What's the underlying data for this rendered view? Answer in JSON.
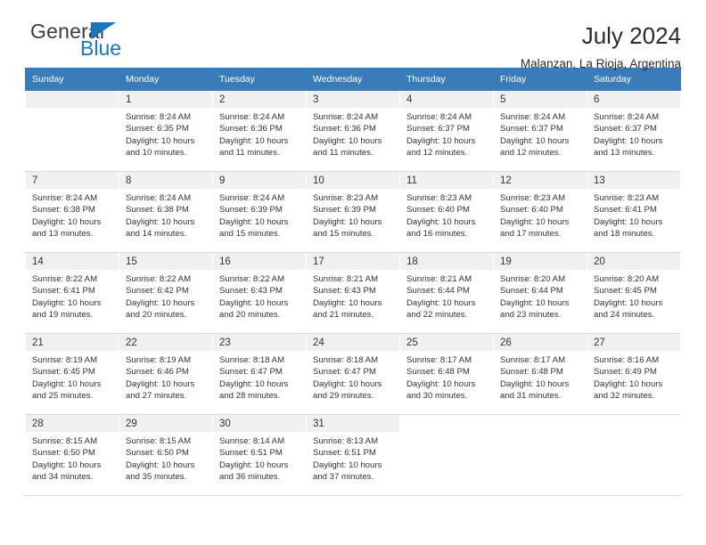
{
  "brand": {
    "name_part1": "General",
    "name_part2": "Blue",
    "triangle_color": "#1c76bc"
  },
  "header": {
    "title": "July 2024",
    "subtitle": "Malanzan, La Rioja, Argentina",
    "header_bg": "#3a7cba",
    "daynum_bg": "#f0f0f0"
  },
  "weekdays": [
    "Sunday",
    "Monday",
    "Tuesday",
    "Wednesday",
    "Thursday",
    "Friday",
    "Saturday"
  ],
  "labels": {
    "sunrise_prefix": "Sunrise: ",
    "sunset_prefix": "Sunset: ",
    "daylight_prefix": "Daylight: "
  },
  "weeks": [
    [
      {
        "day": "",
        "sunrise": "",
        "sunset": "",
        "daylight_line1": "",
        "daylight_line2": ""
      },
      {
        "day": "1",
        "sunrise": "Sunrise: 8:24 AM",
        "sunset": "Sunset: 6:35 PM",
        "daylight_line1": "Daylight: 10 hours",
        "daylight_line2": "and 10 minutes."
      },
      {
        "day": "2",
        "sunrise": "Sunrise: 8:24 AM",
        "sunset": "Sunset: 6:36 PM",
        "daylight_line1": "Daylight: 10 hours",
        "daylight_line2": "and 11 minutes."
      },
      {
        "day": "3",
        "sunrise": "Sunrise: 8:24 AM",
        "sunset": "Sunset: 6:36 PM",
        "daylight_line1": "Daylight: 10 hours",
        "daylight_line2": "and 11 minutes."
      },
      {
        "day": "4",
        "sunrise": "Sunrise: 8:24 AM",
        "sunset": "Sunset: 6:37 PM",
        "daylight_line1": "Daylight: 10 hours",
        "daylight_line2": "and 12 minutes."
      },
      {
        "day": "5",
        "sunrise": "Sunrise: 8:24 AM",
        "sunset": "Sunset: 6:37 PM",
        "daylight_line1": "Daylight: 10 hours",
        "daylight_line2": "and 12 minutes."
      },
      {
        "day": "6",
        "sunrise": "Sunrise: 8:24 AM",
        "sunset": "Sunset: 6:37 PM",
        "daylight_line1": "Daylight: 10 hours",
        "daylight_line2": "and 13 minutes."
      }
    ],
    [
      {
        "day": "7",
        "sunrise": "Sunrise: 8:24 AM",
        "sunset": "Sunset: 6:38 PM",
        "daylight_line1": "Daylight: 10 hours",
        "daylight_line2": "and 13 minutes."
      },
      {
        "day": "8",
        "sunrise": "Sunrise: 8:24 AM",
        "sunset": "Sunset: 6:38 PM",
        "daylight_line1": "Daylight: 10 hours",
        "daylight_line2": "and 14 minutes."
      },
      {
        "day": "9",
        "sunrise": "Sunrise: 8:24 AM",
        "sunset": "Sunset: 6:39 PM",
        "daylight_line1": "Daylight: 10 hours",
        "daylight_line2": "and 15 minutes."
      },
      {
        "day": "10",
        "sunrise": "Sunrise: 8:23 AM",
        "sunset": "Sunset: 6:39 PM",
        "daylight_line1": "Daylight: 10 hours",
        "daylight_line2": "and 15 minutes."
      },
      {
        "day": "11",
        "sunrise": "Sunrise: 8:23 AM",
        "sunset": "Sunset: 6:40 PM",
        "daylight_line1": "Daylight: 10 hours",
        "daylight_line2": "and 16 minutes."
      },
      {
        "day": "12",
        "sunrise": "Sunrise: 8:23 AM",
        "sunset": "Sunset: 6:40 PM",
        "daylight_line1": "Daylight: 10 hours",
        "daylight_line2": "and 17 minutes."
      },
      {
        "day": "13",
        "sunrise": "Sunrise: 8:23 AM",
        "sunset": "Sunset: 6:41 PM",
        "daylight_line1": "Daylight: 10 hours",
        "daylight_line2": "and 18 minutes."
      }
    ],
    [
      {
        "day": "14",
        "sunrise": "Sunrise: 8:22 AM",
        "sunset": "Sunset: 6:41 PM",
        "daylight_line1": "Daylight: 10 hours",
        "daylight_line2": "and 19 minutes."
      },
      {
        "day": "15",
        "sunrise": "Sunrise: 8:22 AM",
        "sunset": "Sunset: 6:42 PM",
        "daylight_line1": "Daylight: 10 hours",
        "daylight_line2": "and 20 minutes."
      },
      {
        "day": "16",
        "sunrise": "Sunrise: 8:22 AM",
        "sunset": "Sunset: 6:43 PM",
        "daylight_line1": "Daylight: 10 hours",
        "daylight_line2": "and 20 minutes."
      },
      {
        "day": "17",
        "sunrise": "Sunrise: 8:21 AM",
        "sunset": "Sunset: 6:43 PM",
        "daylight_line1": "Daylight: 10 hours",
        "daylight_line2": "and 21 minutes."
      },
      {
        "day": "18",
        "sunrise": "Sunrise: 8:21 AM",
        "sunset": "Sunset: 6:44 PM",
        "daylight_line1": "Daylight: 10 hours",
        "daylight_line2": "and 22 minutes."
      },
      {
        "day": "19",
        "sunrise": "Sunrise: 8:20 AM",
        "sunset": "Sunset: 6:44 PM",
        "daylight_line1": "Daylight: 10 hours",
        "daylight_line2": "and 23 minutes."
      },
      {
        "day": "20",
        "sunrise": "Sunrise: 8:20 AM",
        "sunset": "Sunset: 6:45 PM",
        "daylight_line1": "Daylight: 10 hours",
        "daylight_line2": "and 24 minutes."
      }
    ],
    [
      {
        "day": "21",
        "sunrise": "Sunrise: 8:19 AM",
        "sunset": "Sunset: 6:45 PM",
        "daylight_line1": "Daylight: 10 hours",
        "daylight_line2": "and 25 minutes."
      },
      {
        "day": "22",
        "sunrise": "Sunrise: 8:19 AM",
        "sunset": "Sunset: 6:46 PM",
        "daylight_line1": "Daylight: 10 hours",
        "daylight_line2": "and 27 minutes."
      },
      {
        "day": "23",
        "sunrise": "Sunrise: 8:18 AM",
        "sunset": "Sunset: 6:47 PM",
        "daylight_line1": "Daylight: 10 hours",
        "daylight_line2": "and 28 minutes."
      },
      {
        "day": "24",
        "sunrise": "Sunrise: 8:18 AM",
        "sunset": "Sunset: 6:47 PM",
        "daylight_line1": "Daylight: 10 hours",
        "daylight_line2": "and 29 minutes."
      },
      {
        "day": "25",
        "sunrise": "Sunrise: 8:17 AM",
        "sunset": "Sunset: 6:48 PM",
        "daylight_line1": "Daylight: 10 hours",
        "daylight_line2": "and 30 minutes."
      },
      {
        "day": "26",
        "sunrise": "Sunrise: 8:17 AM",
        "sunset": "Sunset: 6:48 PM",
        "daylight_line1": "Daylight: 10 hours",
        "daylight_line2": "and 31 minutes."
      },
      {
        "day": "27",
        "sunrise": "Sunrise: 8:16 AM",
        "sunset": "Sunset: 6:49 PM",
        "daylight_line1": "Daylight: 10 hours",
        "daylight_line2": "and 32 minutes."
      }
    ],
    [
      {
        "day": "28",
        "sunrise": "Sunrise: 8:15 AM",
        "sunset": "Sunset: 6:50 PM",
        "daylight_line1": "Daylight: 10 hours",
        "daylight_line2": "and 34 minutes."
      },
      {
        "day": "29",
        "sunrise": "Sunrise: 8:15 AM",
        "sunset": "Sunset: 6:50 PM",
        "daylight_line1": "Daylight: 10 hours",
        "daylight_line2": "and 35 minutes."
      },
      {
        "day": "30",
        "sunrise": "Sunrise: 8:14 AM",
        "sunset": "Sunset: 6:51 PM",
        "daylight_line1": "Daylight: 10 hours",
        "daylight_line2": "and 36 minutes."
      },
      {
        "day": "31",
        "sunrise": "Sunrise: 8:13 AM",
        "sunset": "Sunset: 6:51 PM",
        "daylight_line1": "Daylight: 10 hours",
        "daylight_line2": "and 37 minutes."
      },
      {
        "day": "",
        "sunrise": "",
        "sunset": "",
        "daylight_line1": "",
        "daylight_line2": ""
      },
      {
        "day": "",
        "sunrise": "",
        "sunset": "",
        "daylight_line1": "",
        "daylight_line2": ""
      },
      {
        "day": "",
        "sunrise": "",
        "sunset": "",
        "daylight_line1": "",
        "daylight_line2": ""
      }
    ]
  ]
}
